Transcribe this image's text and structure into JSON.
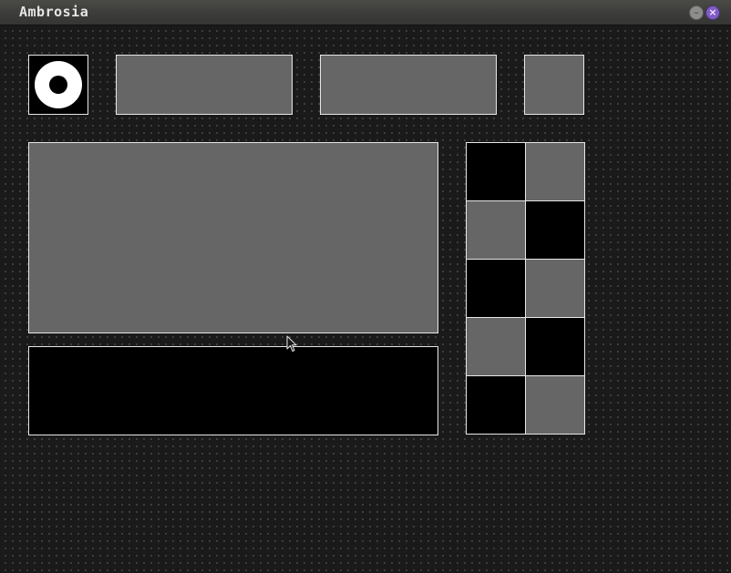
{
  "window": {
    "title": "Ambrosia",
    "minimize_label": "–",
    "close_label": "×",
    "accent_close": "#7f5cc4"
  },
  "toolbar": {
    "logo_icon": "ring-icon",
    "panels": [
      "gray",
      "gray",
      "gray"
    ]
  },
  "main_panel": {
    "color": "gray"
  },
  "bottom_panel": {
    "color": "black"
  },
  "checker_grid": {
    "rows": 5,
    "cols": 2,
    "cells": [
      "black",
      "gray",
      "gray",
      "black",
      "black",
      "gray",
      "gray",
      "black",
      "black",
      "gray"
    ]
  },
  "colors": {
    "background": "#1a1a1a",
    "gray": "#666666",
    "black": "#000000",
    "border": "#e8e8e8"
  }
}
